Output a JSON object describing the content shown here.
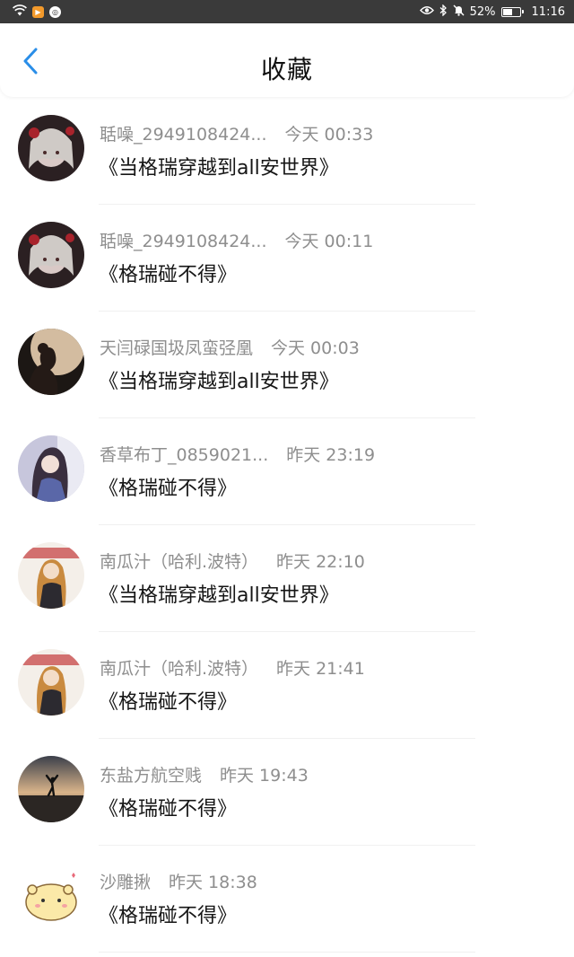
{
  "status_bar": {
    "battery": "52%",
    "time": "11:16"
  },
  "header": {
    "title": "收藏"
  },
  "items": [
    {
      "username": "聒噪_2949108424...",
      "time": "今天 00:33",
      "title": "《当格瑞穿越到all安世界》"
    },
    {
      "username": "聒噪_2949108424...",
      "time": "今天 00:11",
      "title": "《格瑞碰不得》"
    },
    {
      "username": "天闫碌国圾凤蛮弪凰",
      "time": "今天 00:03",
      "title": "《当格瑞穿越到all安世界》"
    },
    {
      "username": "香草布丁_0859021...",
      "time": "昨天 23:19",
      "title": "《格瑞碰不得》"
    },
    {
      "username": "南瓜汁（哈利.波特）",
      "time": "昨天 22:10",
      "title": "《当格瑞穿越到all安世界》"
    },
    {
      "username": "南瓜汁（哈利.波特）",
      "time": "昨天 21:41",
      "title": "《格瑞碰不得》"
    },
    {
      "username": "东盐方航空贱",
      "time": "昨天 19:43",
      "title": "《格瑞碰不得》"
    },
    {
      "username": "沙雕揪",
      "time": "昨天 18:38",
      "title": "《格瑞碰不得》"
    }
  ],
  "colors": {
    "accent": "#2a8ee8",
    "status_bar_bg": "#3a3a3a",
    "meta_text": "#8e8e8e"
  }
}
